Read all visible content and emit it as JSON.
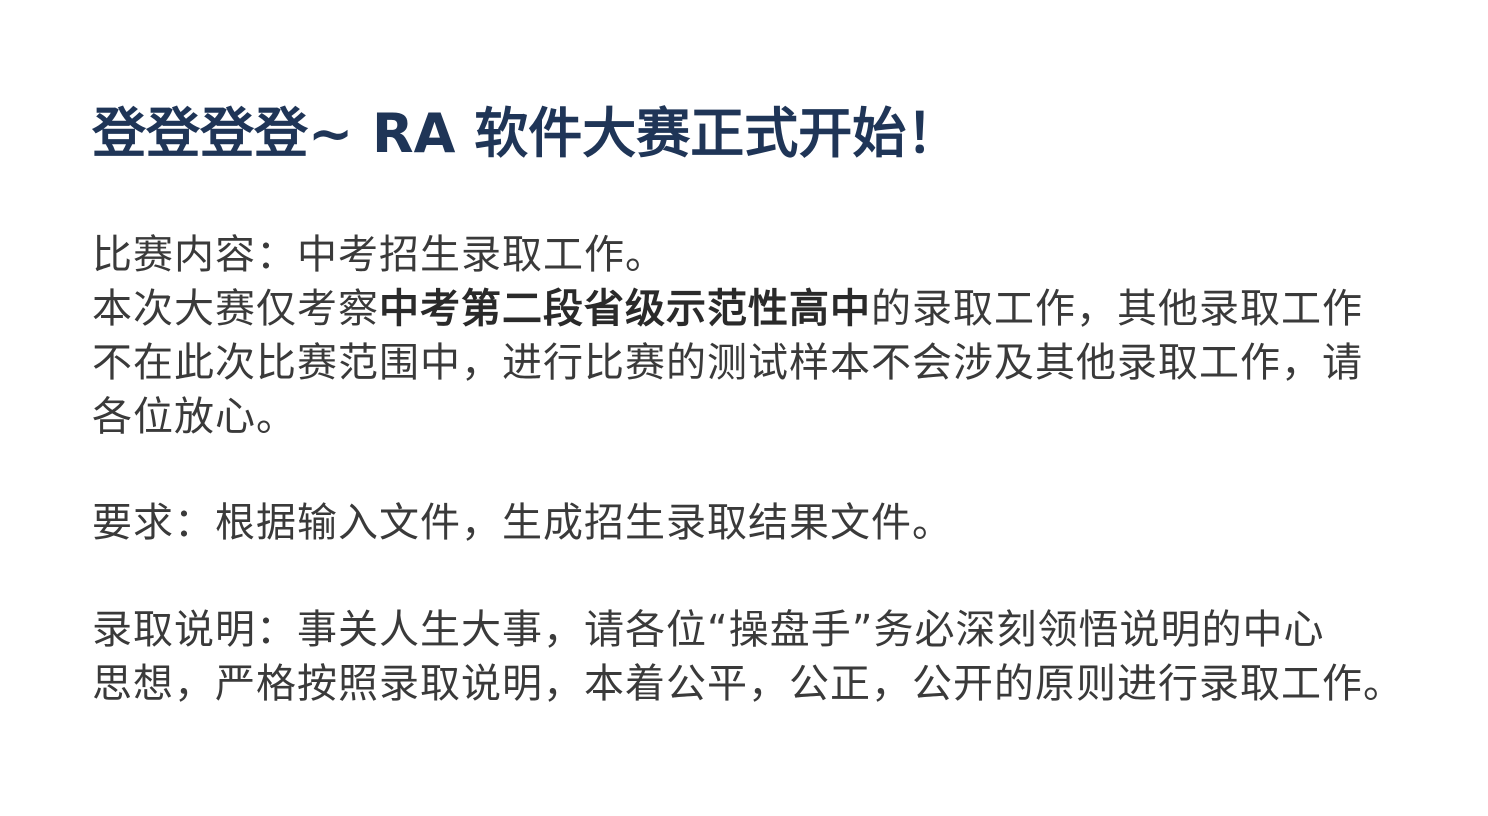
{
  "title": "登登登登~ RA 软件大赛正式开始！",
  "content": {
    "line1": "比赛内容：中考招生录取工作。",
    "line2_pre": "本次大赛仅考察",
    "line2_emph": "中考第二段省级示范性高中",
    "line2_post": "的录取工作，其他录取工作",
    "line3": "不在此次比赛范围中，进行比赛的测试样本不会涉及其他录取工作，请",
    "line4": "各位放心。"
  },
  "requirement": {
    "line1": "要求：根据输入文件，生成招生录取结果文件。"
  },
  "explanation": {
    "line1": "录取说明：事关人生大事，请各位“操盘手”务必深刻领悟说明的中心",
    "line2": "思想，严格按照录取说明，本着公平，公正，公开的原则进行录取工作。"
  },
  "colors": {
    "title": "#1f3557",
    "body": "#3a3a3a",
    "background": "#ffffff"
  }
}
